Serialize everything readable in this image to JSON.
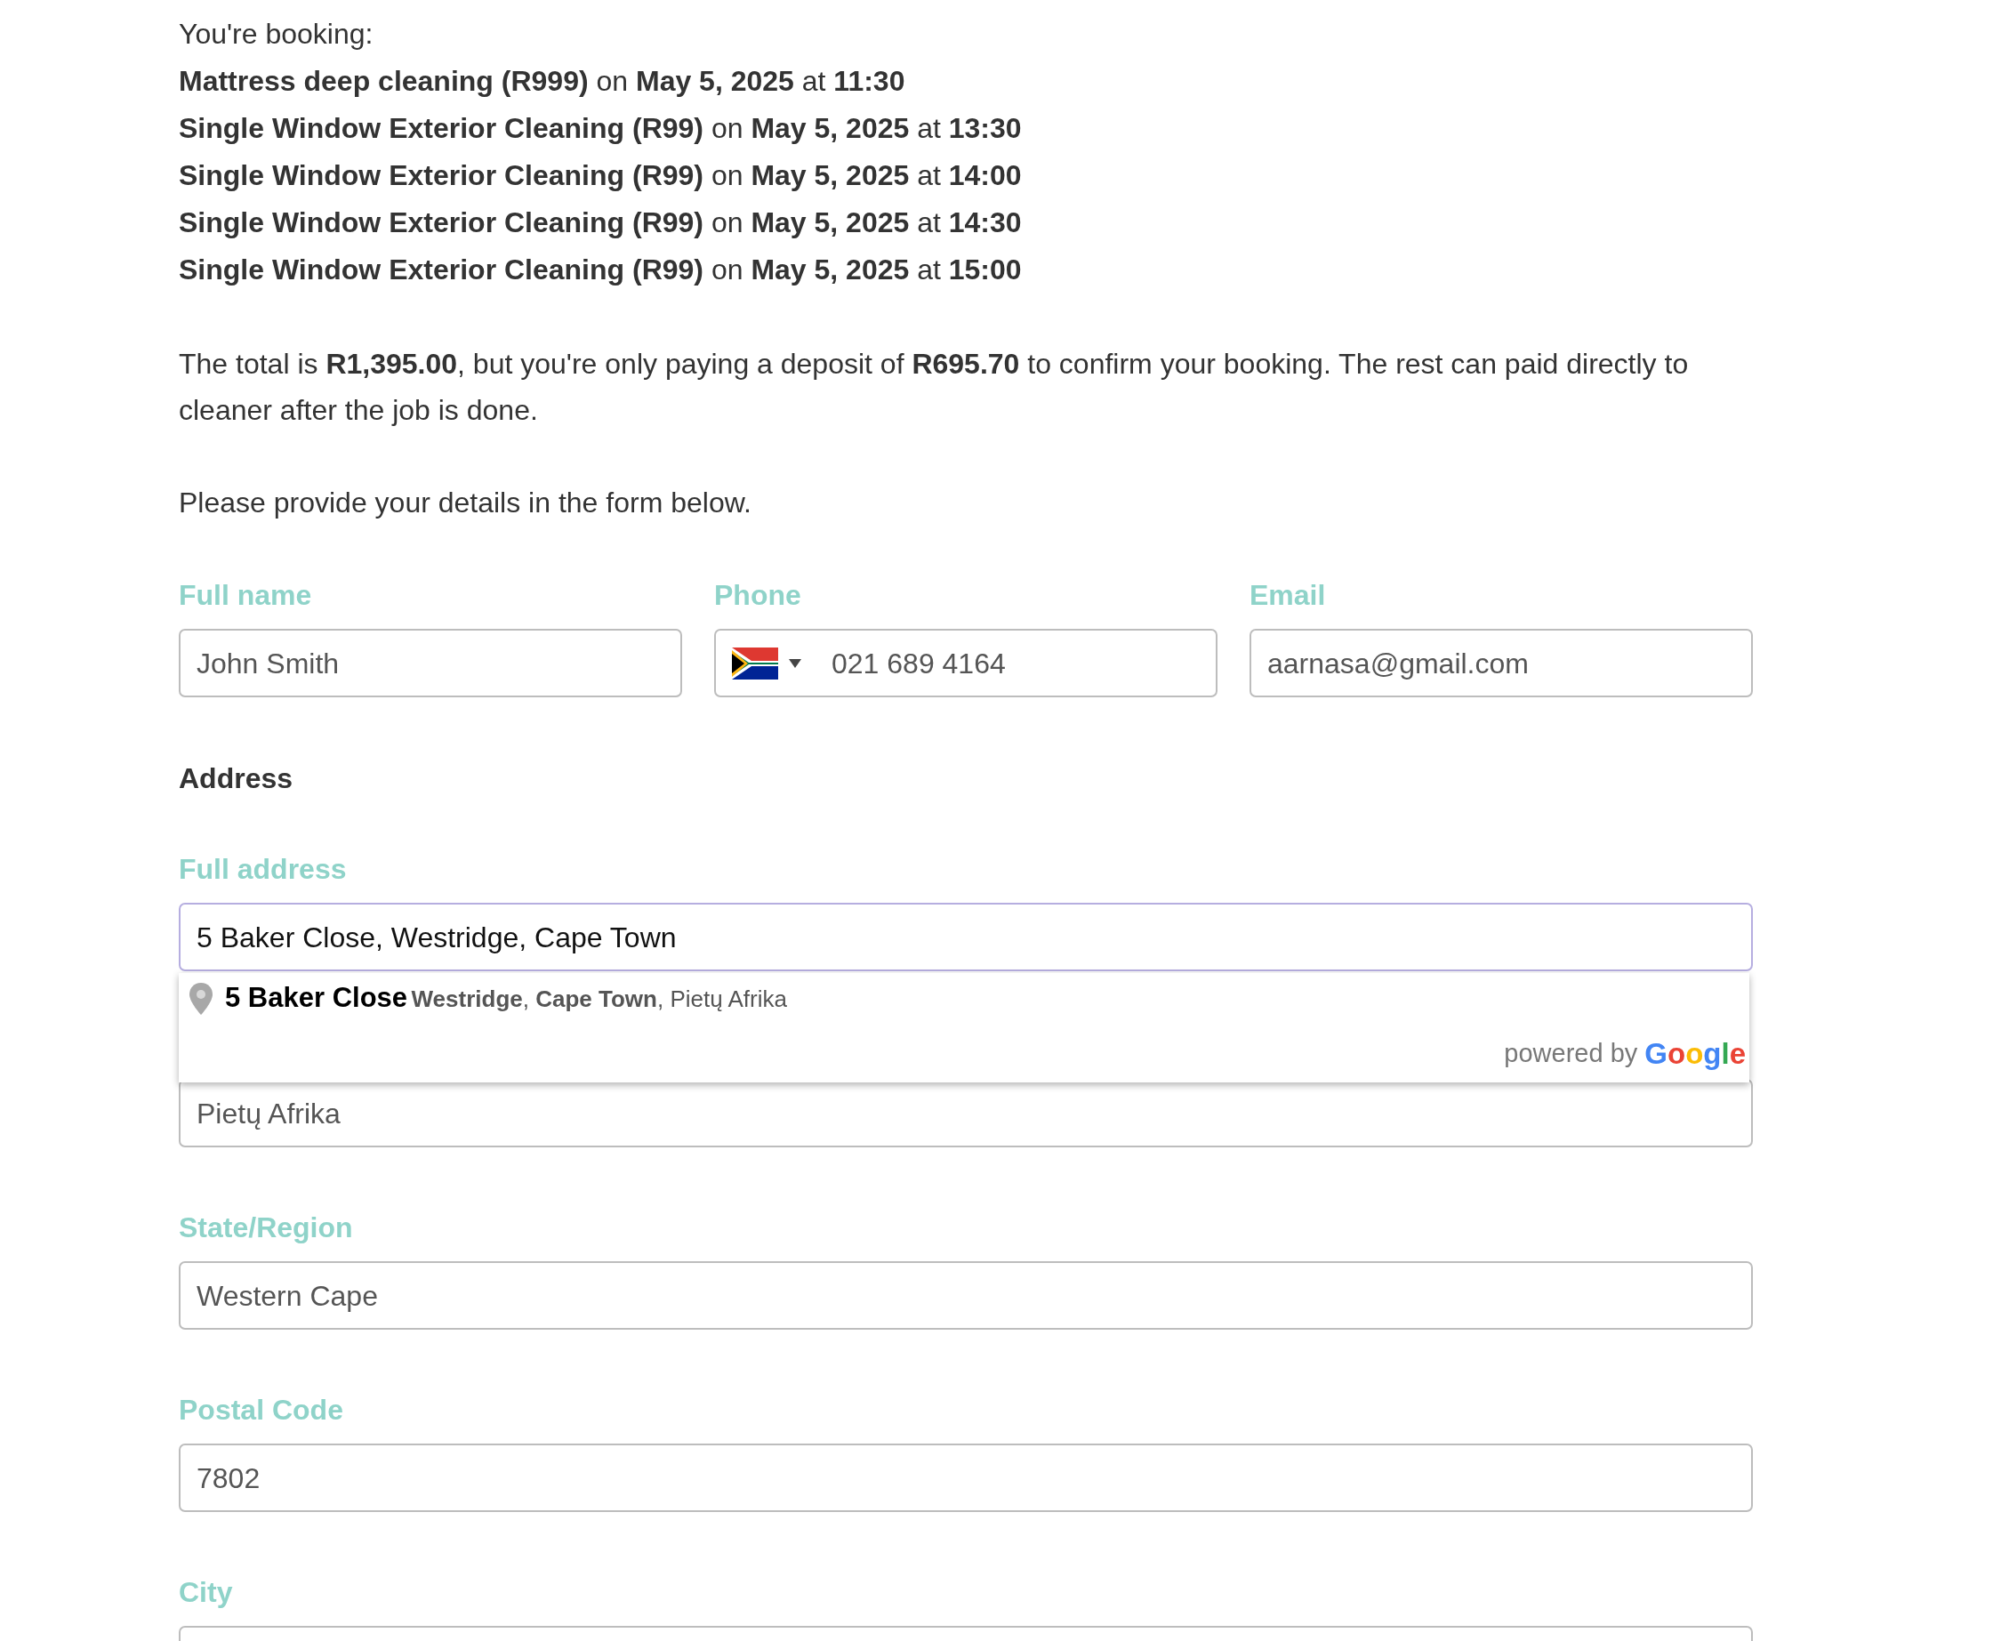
{
  "booking": {
    "intro": "You're booking:",
    "items": [
      "**Mattress deep cleaning (R999)** on **May 5, 2025** at **11:30**",
      "**Single Window Exterior Cleaning (R99)** on **May 5, 2025** at **13:30**",
      "**Single Window Exterior Cleaning (R99)** on **May 5, 2025** at **14:00**",
      "**Single Window Exterior Cleaning (R99)** on **May 5, 2025** at **14:30**",
      "**Single Window Exterior Cleaning (R99)** on **May 5, 2025** at **15:00**"
    ]
  },
  "summary": "The total is **R1,395.00**, but you're only paying a deposit of **R695.70** to confirm your booking. The rest can paid directly to cleaner after the job is done.",
  "instruction": "Please provide your details in the form below.",
  "contact_fields": [
    {
      "kind": "text",
      "label": "Full name",
      "value": "John Smith"
    },
    {
      "kind": "phone",
      "label": "Phone",
      "value": "021 689 4164"
    },
    {
      "kind": "text",
      "label": "Email",
      "value": "aarnasa@gmail.com"
    }
  ],
  "address_heading": "Address",
  "address_fields": [
    {
      "label": "Full address",
      "value": "5 Baker Close, Westridge, Cape Town",
      "focused": true
    },
    {
      "value": "Pietų Afrika",
      "focused": false
    },
    {
      "label": "State/Region",
      "value": "Western Cape",
      "focused": false
    },
    {
      "label": "Postal Code",
      "value": "7802",
      "focused": false
    },
    {
      "label": "City",
      "focused": false
    }
  ],
  "autocomplete": {
    "main_text": "5 Baker Close",
    "secondary_text": "**Westridge**, **Cape Town**, Pietų Afrika",
    "attribution": "powered by",
    "logo_text": "Google"
  }
}
